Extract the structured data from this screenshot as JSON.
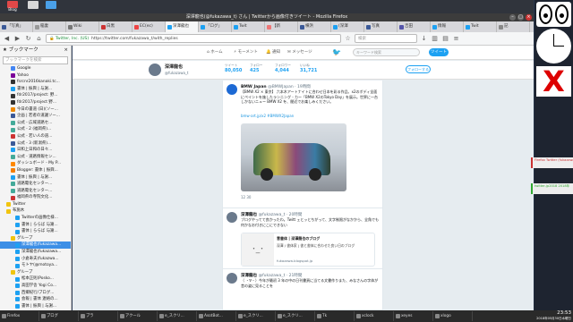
{
  "window": {
    "title": "深澤龍也(@fukazawa_t) さん | Twitterから画像付きツイート - Mozilla Firefox"
  },
  "dock": [
    {
      "label": "Blog",
      "color": "#e04848"
    },
    {
      "label": "",
      "color": "#d8d8d8"
    },
    {
      "label": "",
      "color": "#4aa0e8"
    }
  ],
  "tabs": [
    {
      "label": "「写真」",
      "color": "#3b5998"
    },
    {
      "label": "稲妻",
      "color": "#999"
    },
    {
      "label": "Wiki",
      "color": "#777"
    },
    {
      "label": "白黒",
      "color": "#c33"
    },
    {
      "label": "EC(ec)",
      "color": "#e44"
    },
    {
      "label": "深澤龍也",
      "color": "#1da1f2",
      "active": true
    },
    {
      "label": "「ログ」",
      "color": "#1da1f2"
    },
    {
      "label": "Twit",
      "color": "#1da1f2"
    },
    {
      "label": "【新",
      "color": "#e77"
    },
    {
      "label": "横浜",
      "color": "#3b5998"
    },
    {
      "label": "(深澤",
      "color": "#1da1f2"
    },
    {
      "label": "写真",
      "color": "#3b5998"
    },
    {
      "label": "吉田",
      "color": "#55a"
    },
    {
      "label": "情報",
      "color": "#1da1f2"
    },
    {
      "label": "Twit",
      "color": "#1da1f2"
    },
    {
      "label": "記",
      "color": "#888"
    }
  ],
  "nav": {
    "url_site": "Twitter, Inc. (US)",
    "url": "https://twitter.com/fukazawa_t/with_replies",
    "search_placeholder": "検索"
  },
  "sidebar": {
    "title": "ブックマーク",
    "search_placeholder": "ブックマークを検索",
    "items": [
      {
        "label": "Google",
        "color": "#4285f4",
        "indent": 2
      },
      {
        "label": "Yahoo",
        "color": "#7b0099",
        "indent": 2
      },
      {
        "label": "fsrcnr2016kanaki.tc...",
        "color": "#333",
        "indent": 2
      },
      {
        "label": "書体 | 振興 | 与謝...",
        "color": "#1da1f2",
        "indent": 2
      },
      {
        "label": "fdr2017/project: 野...",
        "color": "#333",
        "indent": 2
      },
      {
        "label": "fdr2017/project 野...",
        "color": "#333",
        "indent": 2
      },
      {
        "label": "今日の書道 (日)(ソー...",
        "color": "#e80",
        "indent": 2
      },
      {
        "label": "企画 | 若者の道議ソー...",
        "color": "#3b5998",
        "indent": 2
      },
      {
        "label": "公式 - 広域道路セ...",
        "color": "#4a9",
        "indent": 2
      },
      {
        "label": "公式 - 2 (福岡県)...",
        "color": "#4a9",
        "indent": 2
      },
      {
        "label": "公式 - 若い人の道...",
        "color": "#c33",
        "indent": 2
      },
      {
        "label": "公式 - 3 (新潟県)...",
        "color": "#3b5998",
        "indent": 2
      },
      {
        "label": "日和上日和の日々...",
        "color": "#1da1f2",
        "indent": 2
      },
      {
        "label": "公式 - 道路情報セン...",
        "color": "#4a9",
        "indent": 2
      },
      {
        "label": "ダッシュボード - My P...",
        "color": "#f80",
        "indent": 2
      },
      {
        "label": "Blogger: 書体 | 振興...",
        "color": "#f57d00",
        "indent": 2
      },
      {
        "label": "書体 | 振興 | 与謝...",
        "color": "#1da1f2",
        "indent": 2
      },
      {
        "label": "道路電化センター...",
        "color": "#4a9",
        "indent": 2
      },
      {
        "label": "道路電化センター...",
        "color": "#4a9",
        "indent": 2
      },
      {
        "label": "福岡県の寺院文化...",
        "color": "#c33",
        "indent": 2
      },
      {
        "label": "Twitter",
        "color": "#f1c40f",
        "indent": 1
      },
      {
        "label": "布施木",
        "color": "#f1c40f",
        "indent": 1
      },
      {
        "label": "Twitterの画像仕様...",
        "color": "#1da1f2",
        "indent": 3
      },
      {
        "label": "書体 | ららば 与謝...",
        "color": "#1da1f2",
        "indent": 3
      },
      {
        "label": "書体 | ららば 与謝...",
        "color": "#1da1f2",
        "indent": 3
      },
      {
        "label": "グループ",
        "color": "#f1c40f",
        "indent": 2
      },
      {
        "label": "深澤龍也(fukazawa...",
        "color": "#1da1f2",
        "indent": 3,
        "selected": true
      },
      {
        "label": "深澤龍也(fukazawa...",
        "color": "#1da1f2",
        "indent": 3
      },
      {
        "label": "小倉寿夫(fukazwa...",
        "color": "#1da1f2",
        "indent": 3
      },
      {
        "label": "モトヤ(@motoya...",
        "color": "#1da1f2",
        "indent": 3
      },
      {
        "label": "グループ",
        "color": "#f1c40f",
        "indent": 2
      },
      {
        "label": "松本正則(Posko...",
        "color": "#1da1f2",
        "indent": 3
      },
      {
        "label": "高田学舎 Yogi Co...",
        "color": "#1da1f2",
        "indent": 3
      },
      {
        "label": "西郷紀行/ブログ...",
        "color": "#1da1f2",
        "indent": 3
      },
      {
        "label": "会報 | 書体 連絡の...",
        "color": "#1da1f2",
        "indent": 3
      },
      {
        "label": "書体 | 振興 | 与謝...",
        "color": "#1da1f2",
        "indent": 3
      }
    ]
  },
  "twitter": {
    "nav": [
      "ホーム",
      "モーメント",
      "通知",
      "メッセージ"
    ],
    "search_placeholder": "キーワード検索",
    "tweet_button": "ツイート",
    "profile": {
      "name": "深澤龍也",
      "handle": "@fukazawa_t",
      "stats": [
        {
          "label": "ツイート",
          "value": "80,050"
        },
        {
          "label": "フォロー",
          "value": "425"
        },
        {
          "label": "フォロワー",
          "value": "4,044"
        },
        {
          "label": "いいね",
          "value": "31,721"
        }
      ],
      "follow_button": "フォローする"
    },
    "tweets": [
      {
        "name": "BMW Japan",
        "handle": "@BMWJapan · 19時間",
        "text": "【BMW X2 × 東京】 六本木アートナイトに合わせ日本を彩る作品、x2のボディ全面にペイントを施したランニング - カー「BMW X2のTokyo Day」を展示。世界に一台しかないニュー BMW X2 を、間近でお楽しみください。",
        "link": "bmw-art.jp/x2 #BMWX2Japan",
        "counts": "12    30"
      },
      {
        "name": "深澤龍也",
        "handle": "@fukazawa_t · 20時間",
        "text": "ブログやってて良かったわ。Twitt ェとッとちがって、文字制限がなかから、全角でも何かなお付きにこにできない",
        "card_title": "意書体 | 深澤龍也のブログ",
        "card_text": "深澤 / 書体家 | 書と書体に合わせた良い日のブログ",
        "card_link": "fukazawa.blogspot.jp",
        "counts": ""
      },
      {
        "name": "深澤龍也",
        "handle": "@fukazawa_t · 21時間",
        "text": "（ ・∀・）今年が最初 3 年の中の日刊書頁に当てる文書作りまた、みなさんの字体が昔の姿に見ることを",
        "counts": ""
      }
    ]
  },
  "taskbar": [
    "Firefox",
    "ブログ",
    "ブラ",
    "アクール",
    "e_スクリ...",
    "AsotBot...",
    "e_スクリ...",
    "e_スクリ...",
    "Tk",
    "xclock",
    "xeyes",
    "xlogo"
  ],
  "clock": {
    "time": "23:53",
    "date": "2018年05月30日水曜日"
  },
  "right_panel": {
    "title": "xlogo",
    "bar1_label": "Firefox Twitter (fukazawa)",
    "bar2_label": "twitter-jp2018 2018年"
  }
}
